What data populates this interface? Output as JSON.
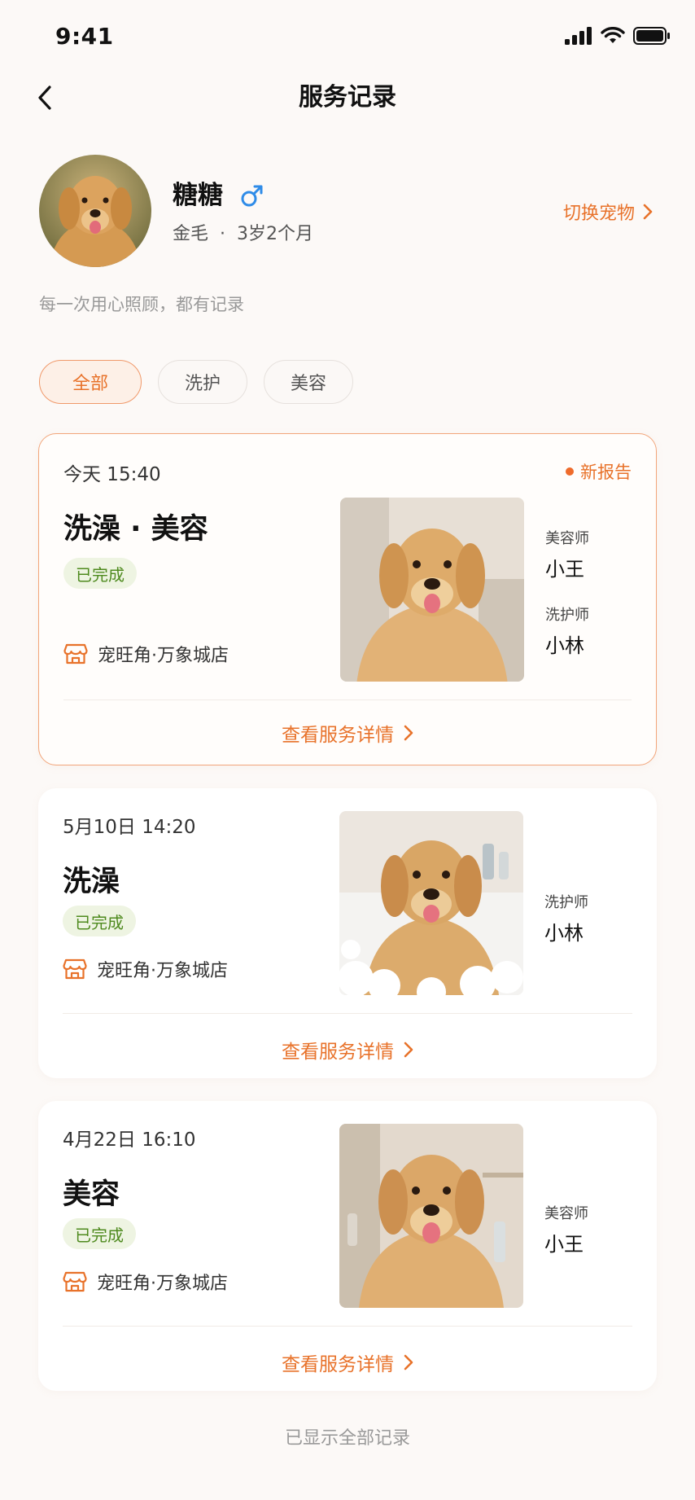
{
  "status_bar": {
    "time": "9:41"
  },
  "nav": {
    "title": "服务记录"
  },
  "pet": {
    "name": "糖糖",
    "breed": "金毛",
    "separator": "·",
    "age": "3岁2个月",
    "switch_label": "切换宠物"
  },
  "tagline": "每一次用心照顾，都有记录",
  "filters": [
    {
      "label": "全部",
      "active": true
    },
    {
      "label": "洗护",
      "active": false
    },
    {
      "label": "美容",
      "active": false
    }
  ],
  "records": [
    {
      "datetime": "今天 15:40",
      "new_report": "新报告",
      "service": "洗澡 · 美容",
      "status": "已完成",
      "store": "宠旺角·万象城店",
      "staff": [
        {
          "role": "美容师",
          "name": "小王"
        },
        {
          "role": "洗护师",
          "name": "小林"
        }
      ],
      "detail_label": "查看服务详情"
    },
    {
      "datetime": "5月10日 14:20",
      "service": "洗澡",
      "status": "已完成",
      "store": "宠旺角·万象城店",
      "staff": [
        {
          "role": "洗护师",
          "name": "小林"
        }
      ],
      "detail_label": "查看服务详情"
    },
    {
      "datetime": "4月22日 16:10",
      "service": "美容",
      "status": "已完成",
      "store": "宠旺角·万象城店",
      "staff": [
        {
          "role": "美容师",
          "name": "小王"
        }
      ],
      "detail_label": "查看服务详情"
    }
  ],
  "footer": "已显示全部记录",
  "colors": {
    "accent": "#e8722a",
    "gender_blue": "#2f8ce8",
    "status_green": "#4e8a1e",
    "status_bg": "#eef4e2",
    "background": "#fcf9f7"
  },
  "icons": {
    "back": "chevron-left-icon",
    "gender": "male-symbol-icon",
    "switch": "chevron-right-icon",
    "store": "store-icon",
    "detail": "chevron-right-icon"
  }
}
